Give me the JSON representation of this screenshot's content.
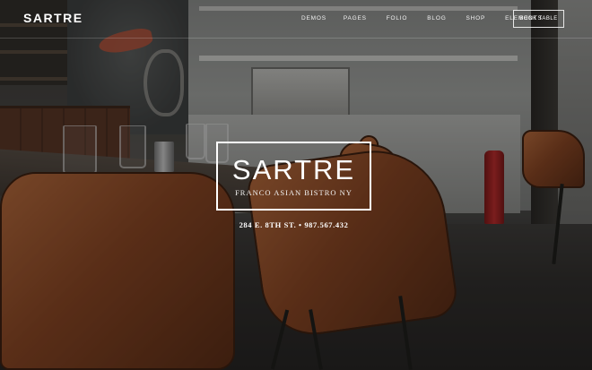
{
  "header": {
    "logo": "SARTRE",
    "nav": [
      "DEMOS",
      "PAGES",
      "FOLIO",
      "BLOG",
      "SHOP",
      "ELEMENTS"
    ],
    "book_button": "BOOK TABLE"
  },
  "hero": {
    "title": "SARTRE",
    "subtitle": "FRANCO ASIAN BISTRO NY",
    "address": "284 E. 8TH ST. • 987.567.432"
  }
}
